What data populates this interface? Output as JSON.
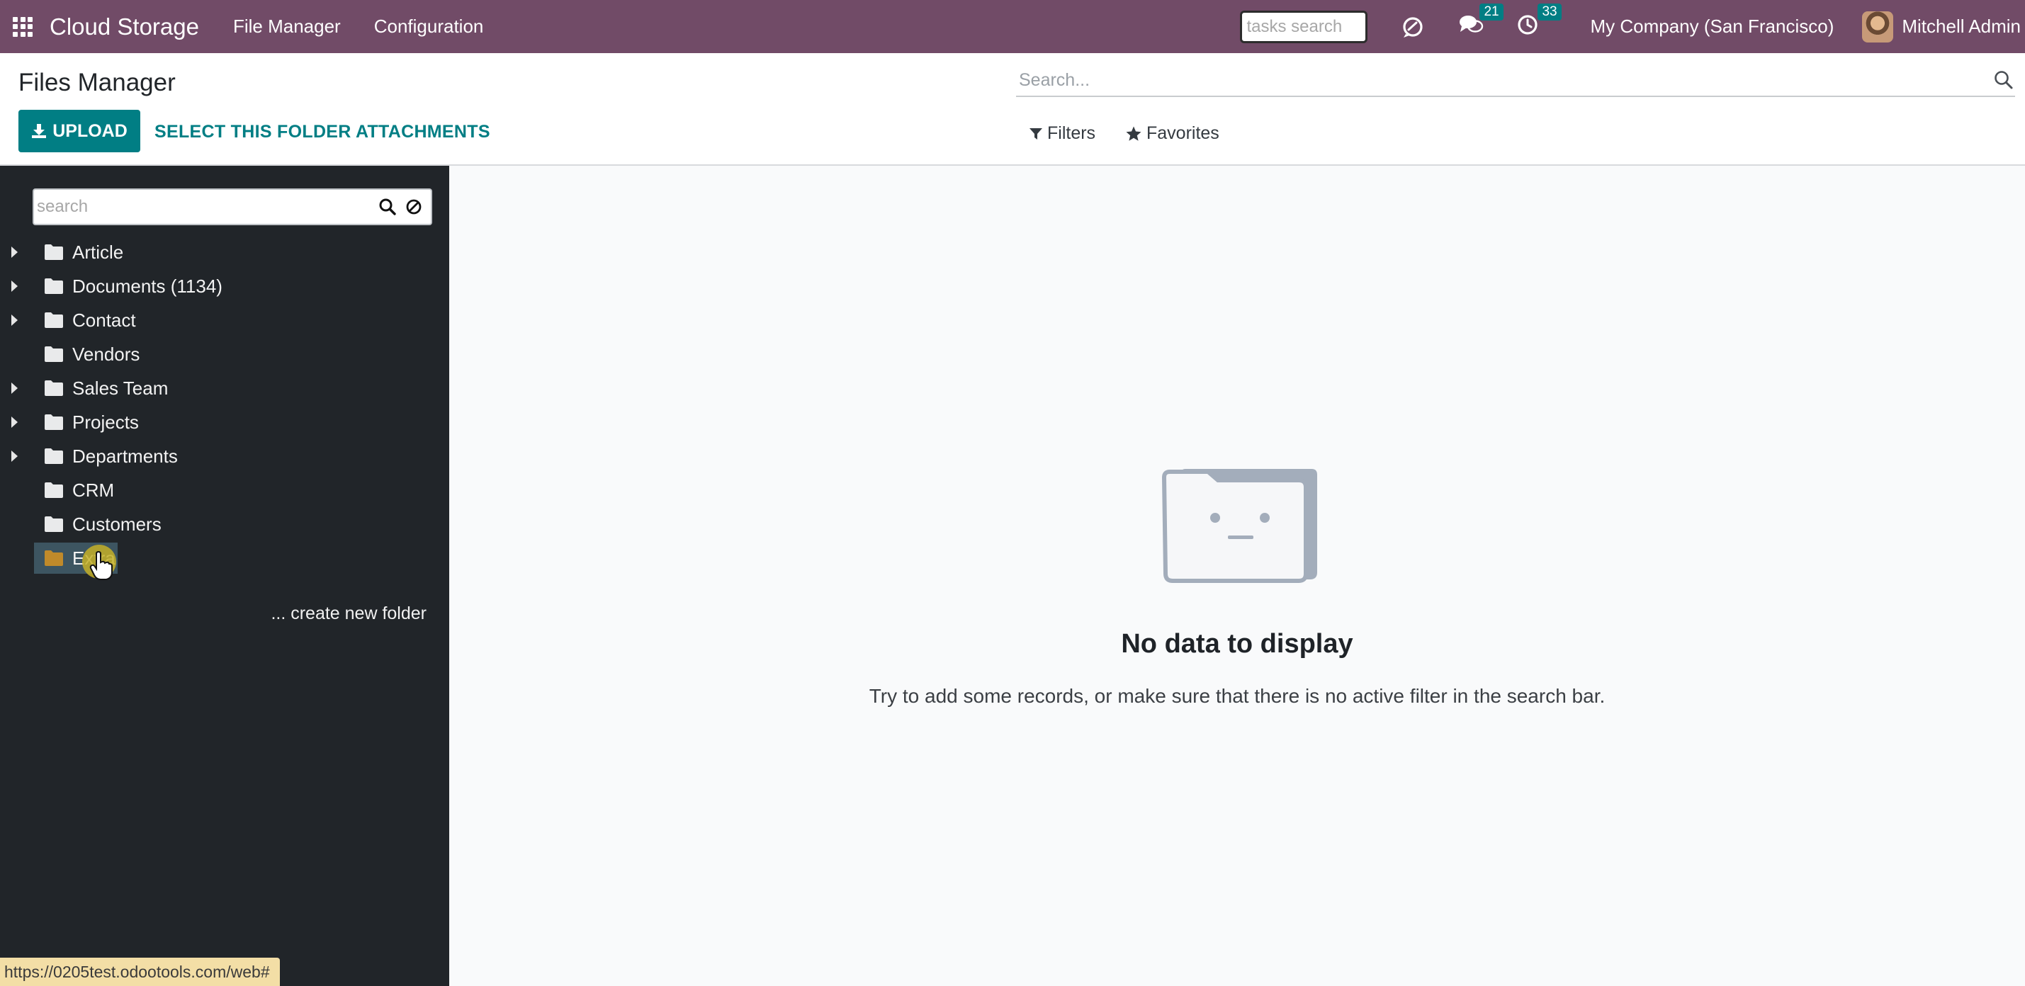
{
  "navbar": {
    "app_name": "Cloud Storage",
    "menus": [
      "File Manager",
      "Configuration"
    ],
    "tasks_search_placeholder": "tasks search",
    "messages_count": "21",
    "activities_count": "33",
    "company": "My Company (San Francisco)",
    "user_name": "Mitchell Admin"
  },
  "control_panel": {
    "title": "Files Manager",
    "upload_label": "UPLOAD",
    "select_folder_label": "SELECT THIS FOLDER ATTACHMENTS",
    "search_placeholder": "Search...",
    "filters_label": "Filters",
    "favorites_label": "Favorites"
  },
  "sidebar": {
    "search_placeholder": "search",
    "folders": [
      {
        "label": "Article",
        "expandable": true
      },
      {
        "label": "Documents (1134)",
        "expandable": true
      },
      {
        "label": "Contact",
        "expandable": true
      },
      {
        "label": "Vendors",
        "expandable": false
      },
      {
        "label": "Sales Team",
        "expandable": true
      },
      {
        "label": "Projects",
        "expandable": true
      },
      {
        "label": "Departments",
        "expandable": true
      },
      {
        "label": "CRM",
        "expandable": false
      },
      {
        "label": "Customers",
        "expandable": false
      },
      {
        "label": "Extra",
        "expandable": false
      }
    ],
    "create_folder_label": "... create new folder"
  },
  "main": {
    "empty_title": "No data to display",
    "empty_help": "Try to add some records, or make sure that there is no active filter in the search bar."
  },
  "status_url": "https://0205test.odootools.com/web#",
  "colors": {
    "navbar": "#714b67",
    "primary": "#017e84",
    "sidebar": "#212529",
    "selected_folder": "#3d5561",
    "selected_folder_icon": "#c08a2a"
  }
}
